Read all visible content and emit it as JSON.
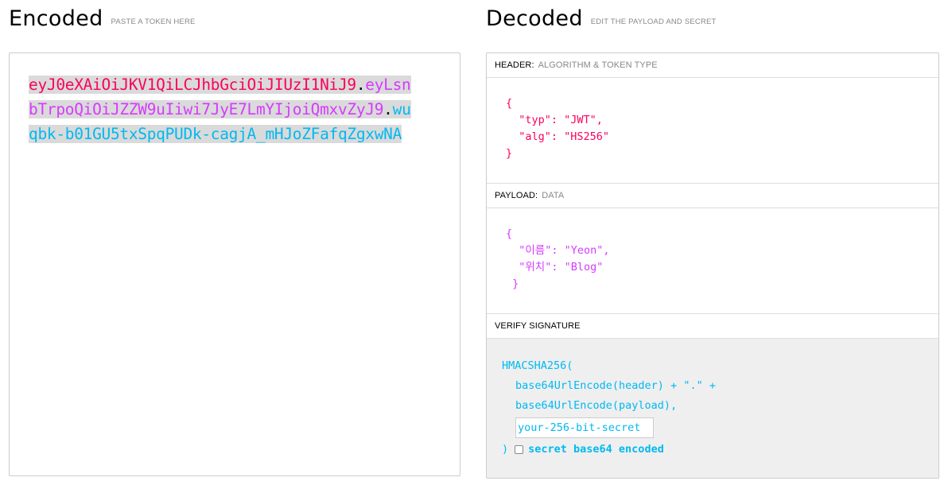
{
  "encoded": {
    "title": "Encoded",
    "hint": "PASTE A TOKEN HERE",
    "token": {
      "header": "eyJ0eXAiOiJKV1QiLCJhbGciOiJIUzI1NiJ9",
      "dot1": ".",
      "payload": "eyLsnbTrpoQiOiJZZW9uIiwi7JyE7LmYIjoiQmxvZyJ9",
      "dot2": ".",
      "signature": "wuqbk-b01GU5txSpqPUDk-cagjA_mHJoZFafqZgxwNA"
    }
  },
  "decoded": {
    "title": "Decoded",
    "hint": "EDIT THE PAYLOAD AND SECRET",
    "header_section": {
      "label": "HEADER:",
      "hint": "ALGORITHM & TOKEN TYPE",
      "json": "{\n  \"typ\": \"JWT\",\n  \"alg\": \"HS256\"\n}"
    },
    "payload_section": {
      "label": "PAYLOAD:",
      "hint": "DATA",
      "json": "{\n  \"이름\": \"Yeon\",\n  \"위치\": \"Blog\"\n }"
    },
    "signature_section": {
      "label": "VERIFY SIGNATURE",
      "fn": "HMACSHA256(",
      "line1": "base64UrlEncode(header) + \".\" +",
      "line2": "base64UrlEncode(payload),",
      "secret_placeholder": "your-256-bit-secret",
      "close": ")",
      "checkbox_label": "secret base64 encoded",
      "checkbox_checked": false
    }
  },
  "colors": {
    "header": "#fb015b",
    "payload": "#d63aff",
    "signature": "#00b9f1"
  }
}
